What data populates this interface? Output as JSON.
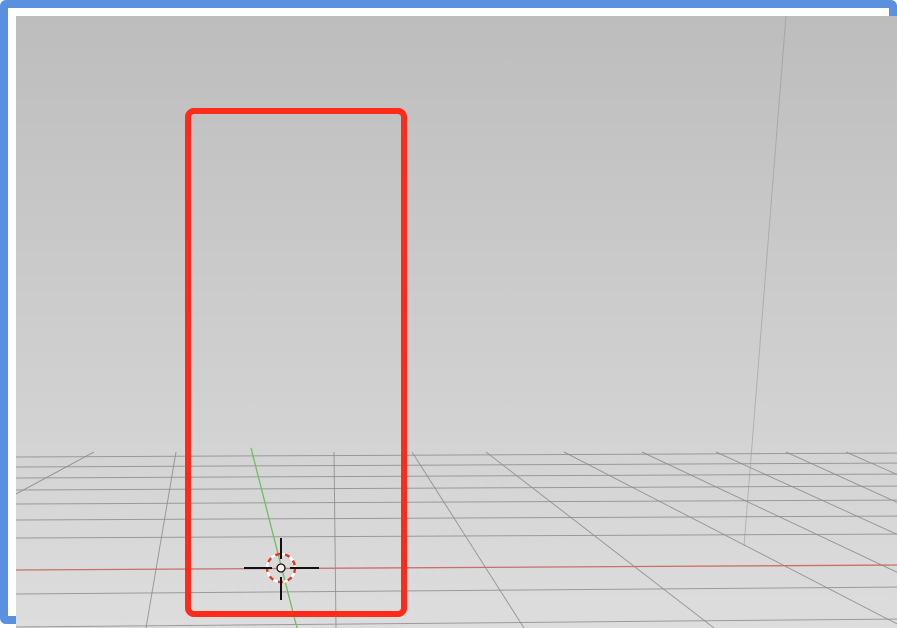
{
  "viewport": {
    "name": "3d-viewport",
    "colors": {
      "frame_border": "#5b8fe0",
      "background_top": "#bdbdbd",
      "background_bottom": "#dddddd",
      "grid_line": "#8a8a8a",
      "x_axis": "#c8706a",
      "y_axis": "#6fbf5a",
      "selection_outline": "#ff2a1a",
      "cursor_cross": "#111111",
      "cursor_ring_red": "#e03a2a",
      "cursor_ring_white": "#ffffff"
    }
  },
  "selected_object": {
    "name": "selected-plane",
    "selected": true
  },
  "cursor_3d": {
    "name": "3d-cursor-icon"
  }
}
